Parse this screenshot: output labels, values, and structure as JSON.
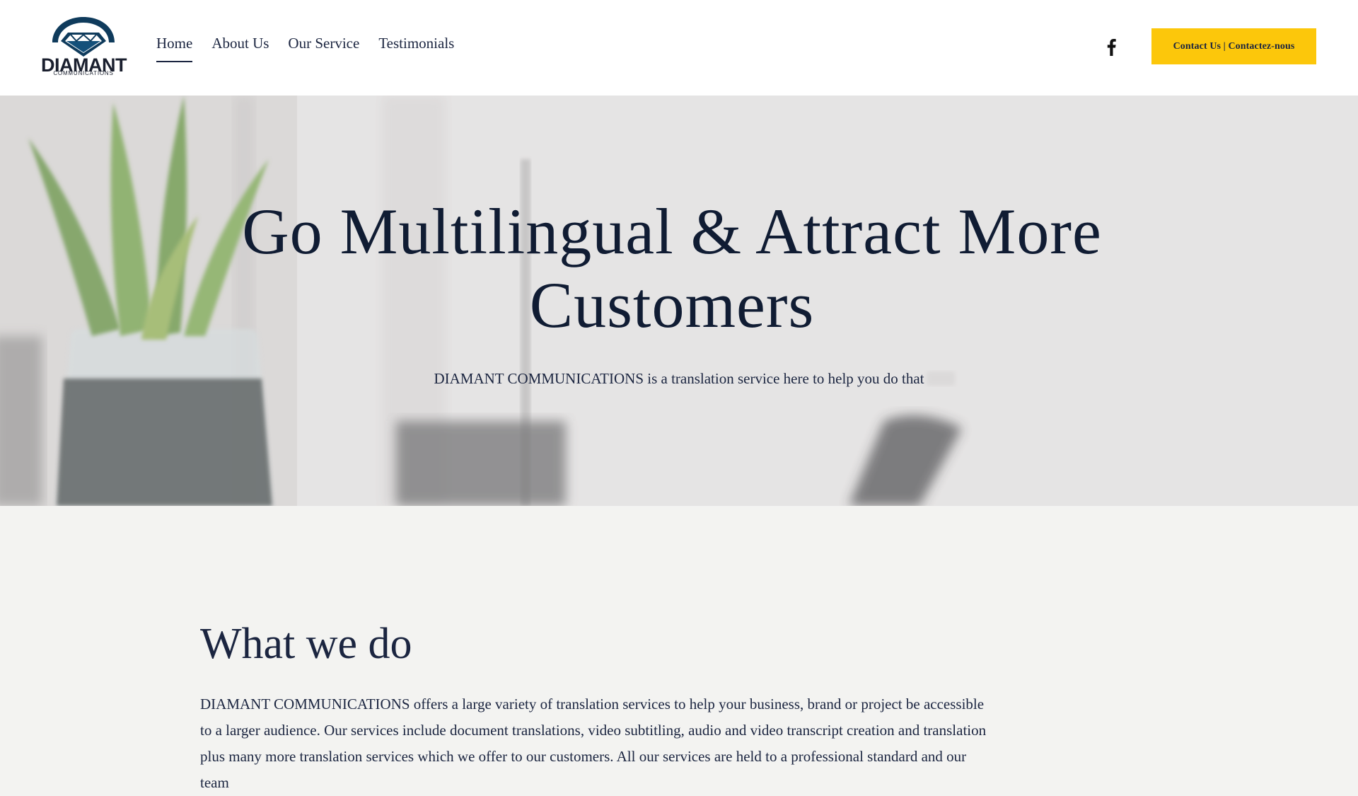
{
  "brand": {
    "logo_text": "DIAMANT",
    "logo_subtext": "COMMUNICATIONS"
  },
  "nav": {
    "items": [
      {
        "label": "Home",
        "active": true
      },
      {
        "label": "About Us",
        "active": false
      },
      {
        "label": "Our Service",
        "active": false
      },
      {
        "label": "Testimonials",
        "active": false
      }
    ]
  },
  "header": {
    "social_icon": "facebook-icon",
    "cta_label": "Contact Us | Contactez-nous",
    "cta_color": "#fcc70b"
  },
  "hero": {
    "title": "Go Multilingual & Attract More Customers",
    "subtitle": "DIAMANT COMMUNICATIONS is a translation service here to help you do that"
  },
  "what_we_do": {
    "title": "What we do",
    "body": "DIAMANT COMMUNICATIONS offers a large variety of translation services to help your business, brand or project be accessible to a larger audience. Our services include document translations, video subtitling, audio and video transcript creation and translation plus many more translation services which we offer to our customers. All our services are held to a professional standard and our team"
  },
  "colors": {
    "navy": "#1b2540",
    "accent": "#fcc70b",
    "section_bg": "#f3f3f1"
  }
}
